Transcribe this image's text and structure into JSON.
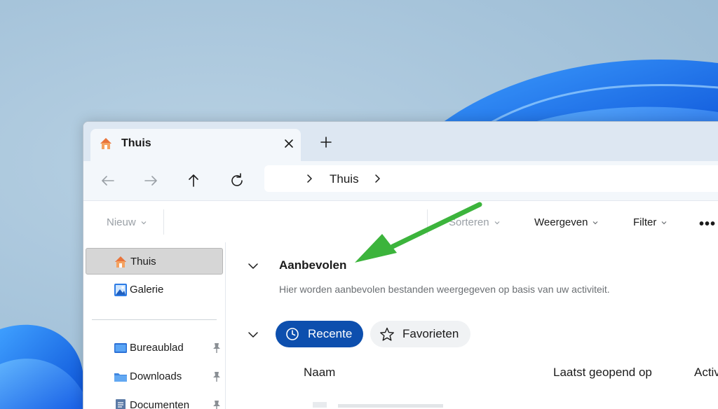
{
  "tab": {
    "title": "Thuis"
  },
  "breadcrumb": {
    "current": "Thuis"
  },
  "commandbar": {
    "new_label": "Nieuw",
    "sort_label": "Sorteren",
    "view_label": "Weergeven",
    "filter_label": "Filter",
    "more_label": "•••"
  },
  "sidebar": {
    "items": [
      {
        "label": "Thuis",
        "icon": "home-icon",
        "selected": true
      },
      {
        "label": "Galerie",
        "icon": "gallery-icon"
      },
      {
        "label": "Bureaublad",
        "icon": "desktop-folder-icon",
        "pinned": true
      },
      {
        "label": "Downloads",
        "icon": "downloads-folder-icon",
        "pinned": true
      },
      {
        "label": "Documenten",
        "icon": "documents-folder-icon",
        "pinned": true
      }
    ]
  },
  "main": {
    "recommended_title": "Aanbevolen",
    "recommended_description": "Hier worden aanbevolen bestanden weergegeven op basis van uw activiteit.",
    "filter_pills": [
      {
        "label": "Recente",
        "active": true,
        "icon": "clock-icon"
      },
      {
        "label": "Favorieten",
        "active": false,
        "icon": "star-icon"
      }
    ],
    "columns": [
      "Naam",
      "Laatst geopend op",
      "Activ"
    ]
  },
  "colors": {
    "accent": "#0d4fae",
    "annotation_arrow": "#3cb43c",
    "selection": "#d6d6d6"
  }
}
